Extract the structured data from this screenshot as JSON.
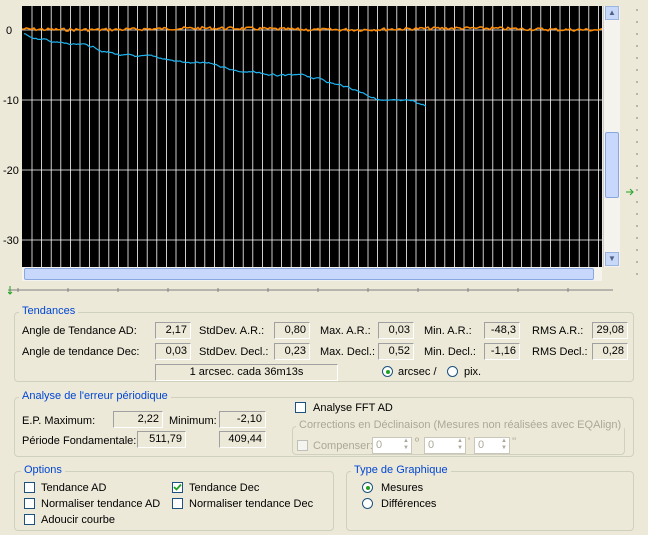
{
  "chart": {
    "y_ticks": [
      "0",
      "-10",
      "-20",
      "-30"
    ],
    "colors": {
      "background": "#000000",
      "ad_series": "#ff8c00",
      "dec_series": "#1fb4f0",
      "grid": "#ffffff"
    }
  },
  "tendances": {
    "title": "Tendances",
    "angle_ad_label": "Angle de Tendance AD:",
    "angle_ad_value": "2,17",
    "angle_dec_label": "Angle de tendance Dec:",
    "angle_dec_value": "0,03",
    "stddev_ar_label": "StdDev. A.R.:",
    "stddev_ar_value": "0,80",
    "stddev_decl_label": "StdDev. Decl.:",
    "stddev_decl_value": "0,23",
    "max_ar_label": "Max. A.R.:",
    "max_ar_value": "0,03",
    "max_decl_label": "Max. Decl.:",
    "max_decl_value": "0,52",
    "min_ar_label": "Min. A.R.:",
    "min_ar_value": "-48,3",
    "min_decl_label": "Min. Decl.:",
    "min_decl_value": "-1,16",
    "rms_ar_label": "RMS A.R.:",
    "rms_ar_value": "29,08",
    "rms_decl_label": "RMS Decl.:",
    "rms_decl_value": "0,28",
    "scale_text": "1 arcsec. cada 36m13s",
    "arcsec_label": "arcsec /",
    "pix_label": "pix."
  },
  "periodic": {
    "title": "Analyse de l'erreur périodique",
    "ep_max_label": "E.P. Maximum:",
    "ep_max_value": "2,22",
    "minimum_label": "Minimum:",
    "minimum_value": "-2,10",
    "periode_label": "Période Fondamentale:",
    "periode_value": "511,79",
    "periode_value2": "409,44",
    "fft_label": "Analyse FFT AD",
    "corrections_title": "Corrections en Déclinaison (Mesures non réalisées avec EQAlign)",
    "compenser_label": "Compenser:",
    "spin1": "0",
    "spin2": "0",
    "spin3": "0",
    "unit1": "º",
    "unit2": "'",
    "unit3": "''"
  },
  "options": {
    "title": "Options",
    "tendance_ad": "Tendance AD",
    "tendance_dec": "Tendance Dec",
    "norm_ad": "Normaliser tendance AD",
    "norm_dec": "Normaliser tendance Dec",
    "adoucir": "Adoucir courbe"
  },
  "graph_type": {
    "title": "Type de Graphique",
    "mesures": "Mesures",
    "differences": "Différences"
  }
}
